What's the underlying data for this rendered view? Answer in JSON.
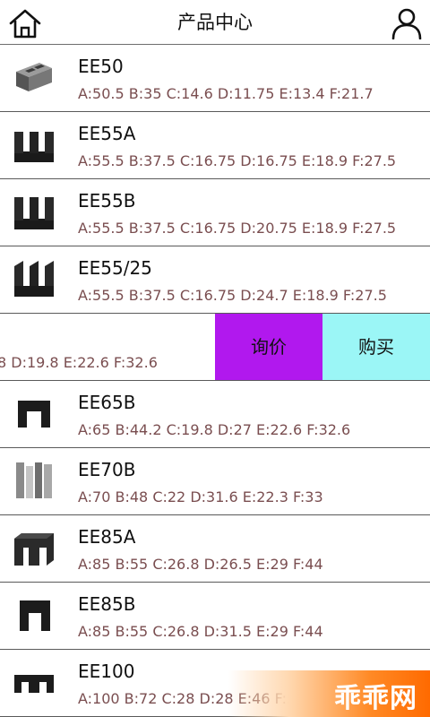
{
  "header": {
    "title": "产品中心",
    "home_icon": "home-icon",
    "user_icon": "user-icon"
  },
  "products": [
    {
      "name": "EE50",
      "spec": "A:50.5  B:35  C:14.6  D:11.75  E:13.4  F:21.7"
    },
    {
      "name": "EE55A",
      "spec": "A:55.5  B:37.5  C:16.75  D:16.75  E:18.9  F:27.5"
    },
    {
      "name": "EE55B",
      "spec": "A:55.5  B:37.5  C:16.75  D:20.75  E:18.9  F:27.5"
    },
    {
      "name": "EE55/25",
      "spec": "A:55.5  B:37.5  C:16.75  D:24.7  E:18.9  F:27.5"
    },
    {
      "name": "",
      "spec": "8  D:19.8  E:22.6  F:32.6"
    },
    {
      "name": "EE65B",
      "spec": "A:65  B:44.2  C:19.8  D:27  E:22.6  F:32.6"
    },
    {
      "name": "EE70B",
      "spec": "A:70  B:48  C:22  D:31.6  E:22.3  F:33"
    },
    {
      "name": "EE85A",
      "spec": "A:85  B:55  C:26.8  D:26.5  E:29  F:44"
    },
    {
      "name": "EE85B",
      "spec": "A:85  B:55  C:26.8  D:31.5  E:29  F:44"
    },
    {
      "name": "EE100",
      "spec": "A:100  B:72  C:28  D:28  E:46  F:5"
    }
  ],
  "swipe_actions": {
    "ask_label": "询价",
    "buy_label": "购买",
    "ask_color": "#b118ee",
    "buy_color": "#9bf6f6"
  },
  "watermark": {
    "text": "乖乖网"
  }
}
